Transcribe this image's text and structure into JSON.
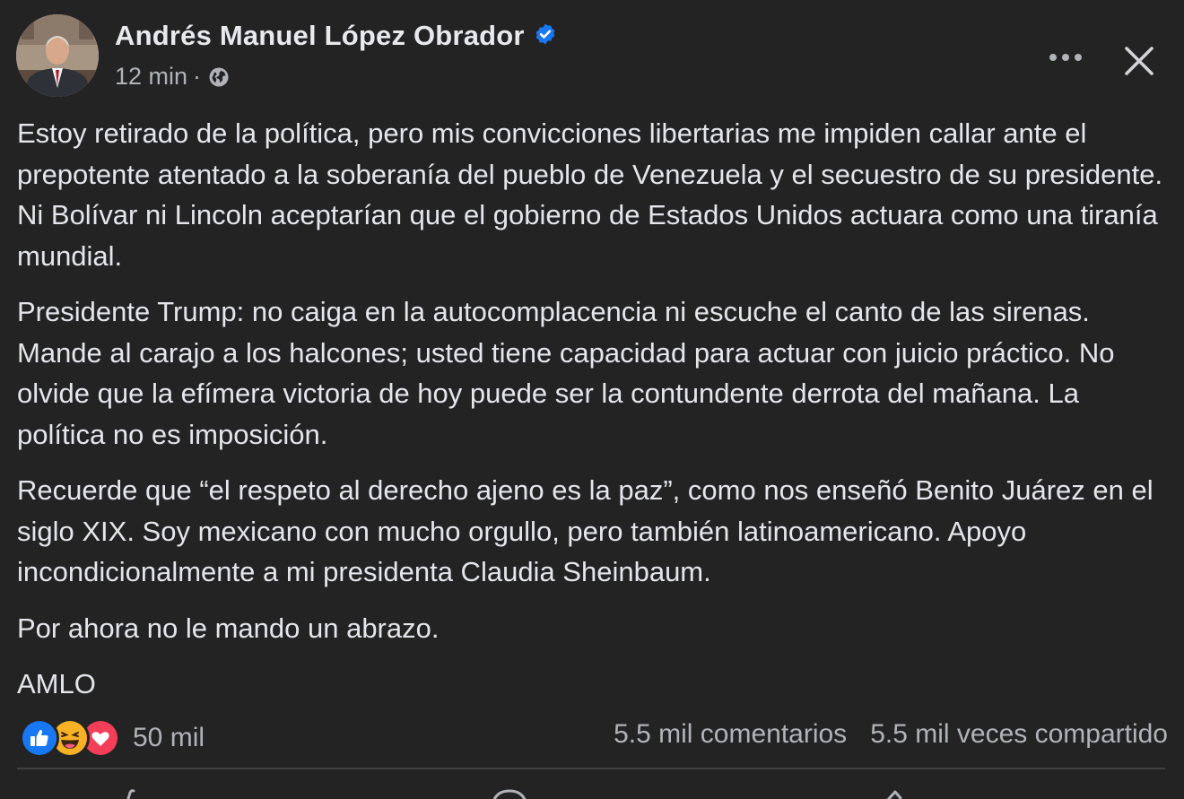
{
  "post": {
    "author": {
      "name": "Andrés Manuel López Obrador",
      "verified": true
    },
    "time": "12 min",
    "separator": "·",
    "audience_icon": "globe-icon",
    "menu": {
      "more_icon": "ellipsis-icon",
      "close_icon": "close-icon"
    },
    "paragraphs": [
      "Estoy retirado de la política, pero mis convicciones libertarias me impiden callar ante el prepotente atentado a la soberanía del pueblo de Venezuela y el secuestro de su presidente. Ni Bolívar ni Lincoln aceptarían que el gobierno de Estados Unidos actuara como una tiranía mundial.",
      "Presidente Trump: no caiga en la autocomplacencia ni escuche el canto de las sirenas. Mande al carajo a los halcones; usted tiene capacidad para actuar con juicio práctico. No olvide que la efímera victoria de hoy puede ser la contundente derrota del mañana. La política no es imposición.",
      "Recuerde que “el respeto al derecho ajeno es la paz”, como nos enseñó Benito Juárez en el siglo XIX. Soy mexicano con mucho orgullo, pero también latinoamericano. Apoyo incondicionalmente a mi presidenta Claudia Sheinbaum.",
      "Por ahora no le mando un abrazo.",
      "AMLO"
    ],
    "stats": {
      "reaction_icons": [
        "like-icon",
        "haha-icon",
        "love-icon"
      ],
      "reactions": "50 mil",
      "comments": "5.5 mil comentarios",
      "shares": "5.5 mil veces compartido"
    },
    "colors": {
      "background": "#232324",
      "text": "#e4e6eb",
      "secondary_text": "#b0b3b8",
      "verified_blue": "#1877f2",
      "like_blue": "#1877f2",
      "love_red": "#f33e58",
      "haha_yellow": "#f7b125"
    }
  }
}
